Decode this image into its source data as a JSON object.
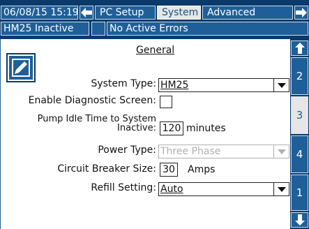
{
  "header": {
    "datetime": "06/08/15 15:19",
    "tabs": [
      {
        "label": "PC Setup",
        "active": false
      },
      {
        "label": "System",
        "active": true
      },
      {
        "label": "Advanced",
        "active": false
      }
    ],
    "status": "HM25 Inactive",
    "errors": "No Active Errors"
  },
  "panel": {
    "title": "General",
    "system_type": {
      "label": "System Type:",
      "value": "HM25"
    },
    "diagnostic": {
      "label": "Enable Diagnostic Screen:",
      "checked": false
    },
    "idle_time": {
      "label_line1": "Pump Idle Time to System",
      "label_line2": "Inactive:",
      "value": "120",
      "unit": "minutes"
    },
    "power_type": {
      "label": "Power Type:",
      "value": "Three Phase",
      "enabled": false
    },
    "breaker": {
      "label": "Circuit Breaker Size:",
      "value": "30",
      "unit": "Amps"
    },
    "refill": {
      "label": "Refill Setting:",
      "value": "Auto"
    }
  },
  "side_tabs": [
    {
      "label": "2",
      "active": false
    },
    {
      "label": "3",
      "active": true
    },
    {
      "label": "4",
      "active": false
    },
    {
      "label": "1",
      "active": false
    }
  ],
  "colors": {
    "nav_dark": "#0a3a6a",
    "nav_blue": "#1f5f99",
    "tab_active": "#e6e6e6"
  }
}
